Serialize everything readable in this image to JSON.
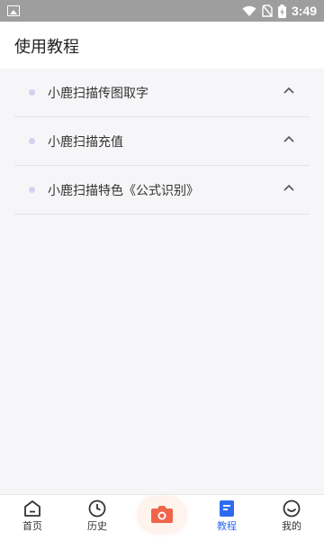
{
  "status_bar": {
    "time": "3:49"
  },
  "header": {
    "title": "使用教程"
  },
  "faq": [
    {
      "label": "小鹿扫描传图取字"
    },
    {
      "label": "小鹿扫描充值"
    },
    {
      "label": "小鹿扫描特色《公式识别》"
    }
  ],
  "tabbar": {
    "home": "首页",
    "history": "历史",
    "tutorial": "教程",
    "mine": "我的"
  },
  "colors": {
    "accent": "#2f6bf0",
    "camera": "#f0644a",
    "dot": "#d3d0f0"
  }
}
